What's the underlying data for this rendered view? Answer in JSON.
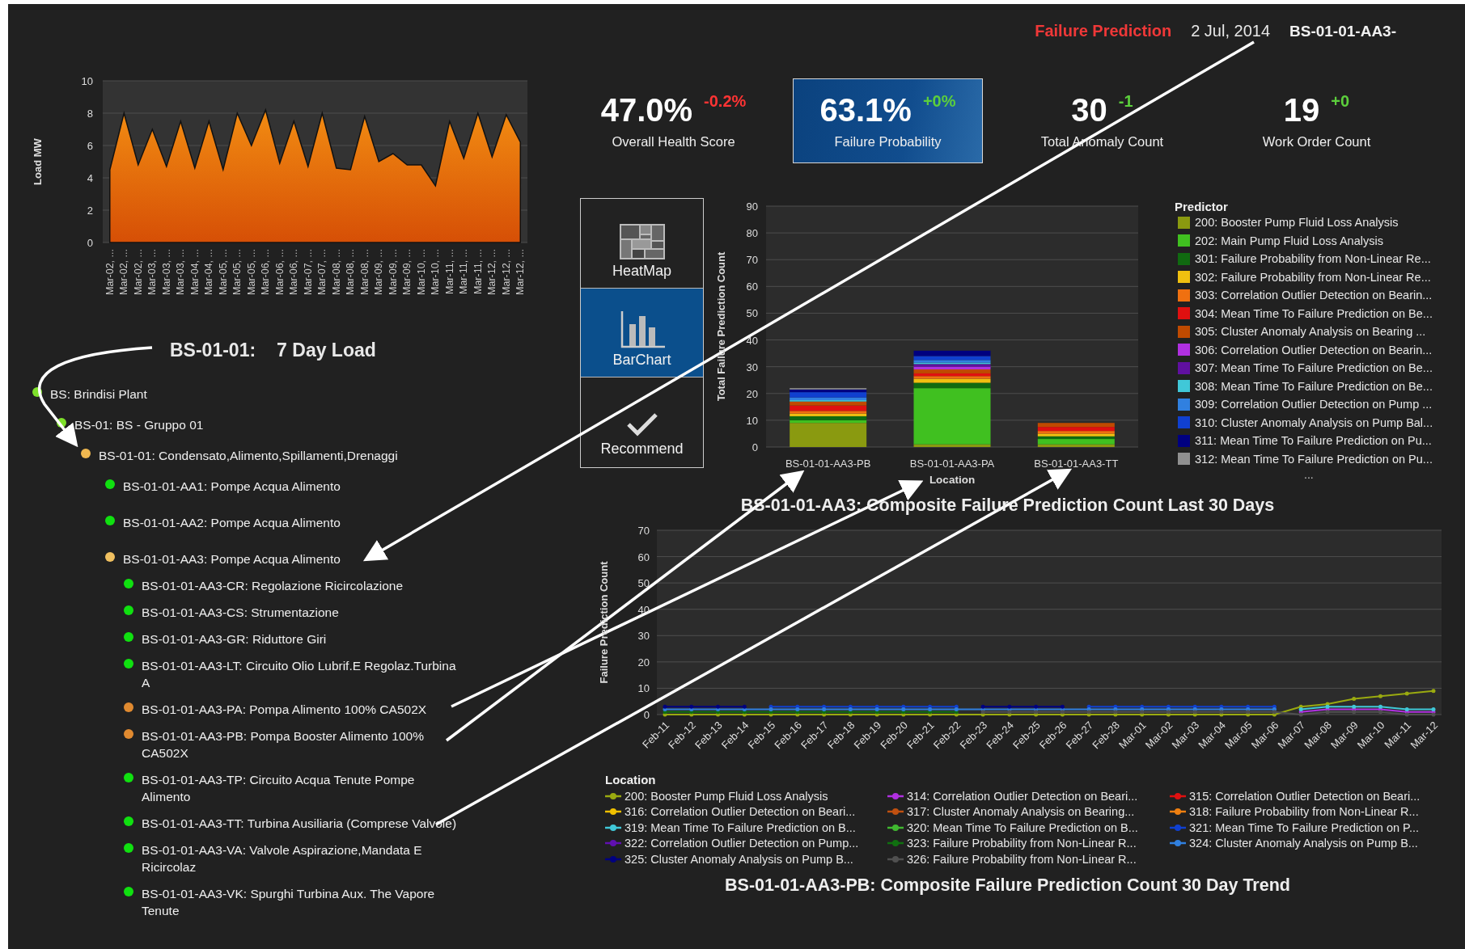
{
  "header": {
    "module": "Failure Prediction",
    "date": "2 Jul, 2014",
    "asset": "BS-01-01-AA3-"
  },
  "load_panel": {
    "title_code": "BS-01-01:",
    "title_text": "7 Day Load",
    "chart_data": {
      "type": "area",
      "grid": true,
      "ylabel": "Load MW",
      "ylim": [
        0,
        10
      ],
      "yticks": [
        0,
        2,
        4,
        6,
        8,
        10
      ],
      "categories": [
        "Mar-02, ...",
        "Mar-02, ...",
        "Mar-02, ...",
        "Mar-03, ...",
        "Mar-03, ...",
        "Mar-03, ...",
        "Mar-04, ...",
        "Mar-04, ...",
        "Mar-05, ...",
        "Mar-05, ...",
        "Mar-05, ...",
        "Mar-06, ...",
        "Mar-06, ...",
        "Mar-06, ...",
        "Mar-07, ...",
        "Mar-07, ...",
        "Mar-08, ...",
        "Mar-08, ...",
        "Mar-08, ...",
        "Mar-09, ...",
        "Mar-09, ...",
        "Mar-09, ...",
        "Mar-10, ...",
        "Mar-10, ...",
        "Mar-11, ...",
        "Mar-11, ...",
        "Mar-11, ...",
        "Mar-12, ...",
        "Mar-12, ...",
        "Mar-12, ..."
      ],
      "values": [
        4.5,
        8,
        4.8,
        7,
        4.7,
        7.5,
        4.6,
        7.5,
        4.5,
        8,
        6,
        8.2,
        4.9,
        7.5,
        4.7,
        8,
        4.6,
        4.5,
        7.8,
        5,
        5.5,
        4.8,
        4.8,
        3.5,
        7.5,
        5.2,
        8,
        5.3,
        7.9,
        6.2
      ]
    }
  },
  "tree": [
    {
      "label": "BS: Brindisi Plant",
      "color": "#7ee02a",
      "children": [
        {
          "label": "BS-01: BS - Gruppo 01",
          "color": "#7ee02a",
          "children": [
            {
              "label": "BS-01-01: Condensato,Alimento,Spillamenti,Drenaggi",
              "color": "#f0b850",
              "children": [
                {
                  "label": "BS-01-01-AA1: Pompe Acqua Alimento",
                  "color": "#10e010"
                },
                {
                  "label": "BS-01-01-AA2: Pompe Acqua Alimento",
                  "color": "#10e010"
                },
                {
                  "label": "BS-01-01-AA3: Pompe Acqua Alimento",
                  "color": "#f0c060",
                  "children": [
                    {
                      "label": "BS-01-01-AA3-CR: Regolazione Ricircolazione",
                      "color": "#10e010"
                    },
                    {
                      "label": "BS-01-01-AA3-CS: Strumentazione",
                      "color": "#10e010"
                    },
                    {
                      "label": "BS-01-01-AA3-GR: Riduttore Giri",
                      "color": "#10e010"
                    },
                    {
                      "label": "BS-01-01-AA3-LT: Circuito Olio Lubrif.E Regolaz.Turbina A",
                      "color": "#10e010"
                    },
                    {
                      "label": "BS-01-01-AA3-PA: Pompa Alimento 100% CA502X",
                      "color": "#e08a30"
                    },
                    {
                      "label": "BS-01-01-AA3-PB: Pompa Booster Alimento 100% CA502X",
                      "color": "#e08a30"
                    },
                    {
                      "label": "BS-01-01-AA3-TP: Circuito Acqua Tenute Pompe Alimento",
                      "color": "#10e010"
                    },
                    {
                      "label": "BS-01-01-AA3-TT: Turbina Ausiliaria (Comprese Valvole)",
                      "color": "#10e010"
                    },
                    {
                      "label": "BS-01-01-AA3-VA: Valvole Aspirazione,Mandata E Ricircolaz",
                      "color": "#10e010"
                    },
                    {
                      "label": "BS-01-01-AA3-VK: Spurghi Turbina Aux. The Vapore Tenute",
                      "color": "#10e010"
                    }
                  ]
                }
              ]
            }
          ]
        }
      ]
    }
  ],
  "kpis": [
    {
      "value": "47.0%",
      "delta": "-0.2%",
      "color": "#ff3434",
      "label": "Overall Health Score",
      "selected": false
    },
    {
      "value": "63.1%",
      "delta": "+0%",
      "color": "#5ccf3c",
      "label": "Failure Probability",
      "selected": true
    },
    {
      "value": "30",
      "delta": "-1",
      "color": "#5ccf3c",
      "label": "Total Anomaly Count",
      "selected": false
    },
    {
      "value": "19",
      "delta": "+0",
      "color": "#5ccf3c",
      "label": "Work Order Count",
      "selected": false
    }
  ],
  "views": [
    {
      "kind": "heatmap",
      "label": "HeatMap",
      "selected": false
    },
    {
      "kind": "barchart",
      "label": "BarChart",
      "selected": true
    },
    {
      "kind": "recommend",
      "label": "Recommend",
      "selected": false
    }
  ],
  "bar_panel": {
    "legend_title": "Predictor",
    "legend_more": "...",
    "chart_data": {
      "type": "bar",
      "grid": true,
      "stacked": true,
      "title": "BS-01-01-AA3: Composite Failure Prediction Count Last 30 Days",
      "xlabel": "Location",
      "ylabel": "Total Failure Prediction Count",
      "ylim": [
        0,
        90
      ],
      "yticks": [
        0,
        10,
        20,
        30,
        40,
        50,
        60,
        70,
        80,
        90
      ],
      "categories": [
        "BS-01-01-AA3-PB",
        "BS-01-01-AA3-PA",
        "BS-01-01-AA3-TT"
      ],
      "series": [
        {
          "name": "200: Booster Pump Fluid Loss Analysis",
          "color": "#8a9a10",
          "values": [
            9,
            1,
            1
          ]
        },
        {
          "name": "202: Main Pump Fluid Loss Analysis",
          "color": "#40c020",
          "values": [
            1,
            21,
            2
          ]
        },
        {
          "name": "301: Failure Probability from Non-Linear Re...",
          "color": "#106a10",
          "values": [
            1.5,
            2,
            1
          ]
        },
        {
          "name": "302: Failure Probability from Non-Linear Re...",
          "color": "#f0c010",
          "values": [
            1,
            1.5,
            1
          ]
        },
        {
          "name": "303: Correlation Outlier Detection on Bearin...",
          "color": "#f07010",
          "values": [
            1,
            1,
            1
          ]
        },
        {
          "name": "304: Mean Time To Failure Prediction on Be...",
          "color": "#e01010",
          "values": [
            2,
            1,
            1.5
          ]
        },
        {
          "name": "305: Cluster Anomaly Analysis on Bearing ...",
          "color": "#c04a00",
          "values": [
            1.5,
            1.5,
            1.5
          ]
        },
        {
          "name": "306: Correlation Outlier Detection on Bearin...",
          "color": "#b030e0",
          "values": [
            0,
            1,
            0
          ]
        },
        {
          "name": "307: Mean Time To Failure Prediction on Be...",
          "color": "#6010a0",
          "values": [
            0,
            1,
            0
          ]
        },
        {
          "name": "308: Mean Time To Failure Prediction on Be...",
          "color": "#40c8d8",
          "values": [
            0.5,
            0.5,
            0
          ]
        },
        {
          "name": "309: Correlation Outlier Detection on Pump ...",
          "color": "#3080e0",
          "values": [
            1,
            1,
            0
          ]
        },
        {
          "name": "310: Cluster Anomaly Analysis on Pump Bal...",
          "color": "#1040d0",
          "values": [
            2,
            1.5,
            0
          ]
        },
        {
          "name": "311: Mean Time To Failure Prediction on Pu...",
          "color": "#000080",
          "values": [
            1,
            2,
            0
          ]
        },
        {
          "name": "312: Mean Time To Failure Prediction on Pu...",
          "color": "#909090",
          "values": [
            0.5,
            0,
            0
          ]
        }
      ]
    }
  },
  "line_panel": {
    "legend_title": "Location",
    "chart_data": {
      "type": "line",
      "grid": true,
      "title": "BS-01-01-AA3-PB: Composite Failure Prediction Count 30 Day Trend",
      "ylabel": "Failure Prediction Count",
      "ylim": [
        0,
        70
      ],
      "yticks": [
        0,
        10,
        20,
        30,
        40,
        50,
        60,
        70
      ],
      "categories": [
        "Feb-11",
        "Feb-12",
        "Feb-13",
        "Feb-14",
        "Feb-15",
        "Feb-16",
        "Feb-17",
        "Feb-18",
        "Feb-19",
        "Feb-20",
        "Feb-21",
        "Feb-22",
        "Feb-23",
        "Feb-24",
        "Feb-25",
        "Feb-26",
        "Feb-27",
        "Feb-28",
        "Mar-01",
        "Mar-02",
        "Mar-03",
        "Mar-04",
        "Mar-05",
        "Mar-06",
        "Mar-07",
        "Mar-08",
        "Mar-09",
        "Mar-10",
        "Mar-11",
        "Mar-12"
      ],
      "series": [
        {
          "name": "200: Booster Pump Fluid Loss Analysis",
          "color": "#9aaa10",
          "values": [
            0,
            0,
            0,
            0,
            0,
            0,
            0,
            0,
            0,
            0,
            0,
            0,
            0,
            0,
            0,
            0,
            0,
            0,
            0,
            0,
            0,
            0,
            0,
            0,
            3,
            4,
            6,
            7,
            8,
            9
          ]
        },
        {
          "name": "314: Correlation Outlier Detection on Beari...",
          "color": "#b030e0",
          "values": [
            null,
            null,
            null,
            null,
            null,
            null,
            null,
            null,
            null,
            null,
            null,
            null,
            null,
            null,
            null,
            null,
            null,
            null,
            null,
            null,
            null,
            null,
            null,
            null,
            1,
            2,
            2,
            2,
            1,
            1
          ]
        },
        {
          "name": "315: Correlation Outlier Detection on Beari...",
          "color": "#e01010",
          "values": [
            null,
            null,
            null,
            null,
            null,
            null,
            null,
            null,
            null,
            null,
            null,
            null,
            null,
            null,
            null,
            null,
            null,
            null,
            null,
            null,
            null,
            null,
            null,
            null,
            null,
            null,
            null,
            null,
            null,
            null
          ]
        },
        {
          "name": "316: Correlation Outlier Detection on Beari...",
          "color": "#f0c000",
          "values": [
            null,
            null,
            null,
            null,
            null,
            null,
            null,
            null,
            null,
            null,
            null,
            null,
            null,
            null,
            null,
            null,
            null,
            null,
            null,
            null,
            null,
            null,
            null,
            null,
            null,
            null,
            null,
            null,
            null,
            null
          ]
        },
        {
          "name": "317: Cluster Anomaly Analysis on Bearing...",
          "color": "#c05010",
          "values": [
            null,
            null,
            null,
            null,
            null,
            null,
            null,
            null,
            null,
            null,
            null,
            null,
            null,
            null,
            null,
            null,
            null,
            null,
            null,
            null,
            null,
            null,
            null,
            null,
            null,
            null,
            null,
            null,
            null,
            null
          ]
        },
        {
          "name": "318: Failure Probability from Non-Linear R...",
          "color": "#f08010",
          "values": [
            null,
            null,
            null,
            null,
            null,
            null,
            null,
            null,
            null,
            null,
            null,
            null,
            null,
            null,
            null,
            null,
            null,
            null,
            null,
            null,
            null,
            null,
            null,
            null,
            null,
            null,
            null,
            null,
            null,
            null
          ]
        },
        {
          "name": "319: Mean Time To Failure Prediction on B...",
          "color": "#40c8d8",
          "values": [
            null,
            null,
            null,
            null,
            null,
            null,
            null,
            null,
            null,
            null,
            null,
            null,
            null,
            null,
            null,
            null,
            null,
            null,
            null,
            null,
            null,
            null,
            null,
            null,
            2,
            3,
            3,
            3,
            2,
            2
          ]
        },
        {
          "name": "320: Mean Time To Failure Prediction on B...",
          "color": "#40b830",
          "values": [
            null,
            null,
            null,
            null,
            null,
            null,
            null,
            null,
            null,
            null,
            null,
            null,
            null,
            null,
            null,
            null,
            null,
            null,
            null,
            null,
            null,
            null,
            null,
            null,
            null,
            null,
            null,
            null,
            null,
            null
          ]
        },
        {
          "name": "321: Mean Time To Failure Prediction on P...",
          "color": "#1040d0",
          "values": [
            null,
            null,
            null,
            null,
            3,
            3,
            3,
            3,
            3,
            3,
            3,
            3,
            null,
            null,
            null,
            null,
            3,
            3,
            3,
            3,
            3,
            3,
            3,
            3,
            null,
            null,
            null,
            null,
            null,
            null
          ]
        },
        {
          "name": "322: Correlation Outlier Detection on Pump...",
          "color": "#6010b0",
          "values": [
            null,
            null,
            null,
            null,
            null,
            null,
            null,
            null,
            null,
            null,
            null,
            null,
            null,
            null,
            null,
            null,
            null,
            null,
            null,
            null,
            null,
            null,
            null,
            null,
            null,
            null,
            null,
            null,
            null,
            null
          ]
        },
        {
          "name": "323: Failure Probability from Non-Linear R...",
          "color": "#107010",
          "values": [
            1,
            1,
            1,
            1,
            1,
            1,
            1,
            1,
            1,
            1,
            1,
            1,
            null,
            null,
            null,
            null,
            null,
            null,
            null,
            null,
            null,
            null,
            null,
            null,
            null,
            null,
            null,
            null,
            null,
            null
          ]
        },
        {
          "name": "324: Cluster Anomaly Analysis on Pump B...",
          "color": "#3080e0",
          "values": [
            2,
            2,
            2,
            2,
            2,
            2,
            2,
            2,
            2,
            2,
            2,
            2,
            2,
            2,
            2,
            2,
            2,
            2,
            2,
            2,
            2,
            2,
            2,
            2,
            null,
            null,
            null,
            null,
            null,
            null
          ]
        },
        {
          "name": "325: Cluster Anomaly Analysis on Pump B...",
          "color": "#000080",
          "values": [
            3,
            3,
            3,
            3,
            null,
            null,
            null,
            null,
            null,
            null,
            null,
            null,
            3,
            3,
            3,
            3,
            null,
            null,
            null,
            null,
            null,
            null,
            null,
            null,
            null,
            null,
            null,
            null,
            null,
            null
          ]
        },
        {
          "name": "326: Failure Probability from Non-Linear R...",
          "color": "#505050",
          "values": [
            null,
            null,
            null,
            null,
            null,
            null,
            null,
            null,
            null,
            null,
            null,
            null,
            1,
            1,
            1,
            1,
            1,
            1,
            1,
            1,
            1,
            1,
            1,
            1,
            0,
            1,
            1,
            1,
            0,
            0
          ]
        }
      ]
    }
  }
}
